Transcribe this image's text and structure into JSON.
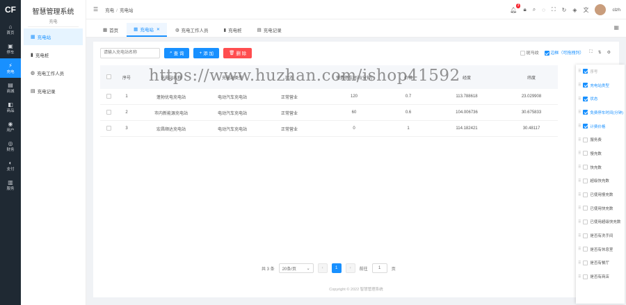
{
  "leftbar": {
    "logo": "CF",
    "items": [
      {
        "icon": "⌂",
        "label": "首页"
      },
      {
        "icon": "▣",
        "label": "停车"
      },
      {
        "icon": "⚡",
        "label": "充电"
      },
      {
        "icon": "▤",
        "label": "商城"
      },
      {
        "icon": "◧",
        "label": "商品"
      },
      {
        "icon": "◉",
        "label": "用户"
      },
      {
        "icon": "◎",
        "label": "财务"
      },
      {
        "icon": "◐",
        "label": "支付"
      },
      {
        "icon": "▥",
        "label": "服务"
      }
    ]
  },
  "sidebar": {
    "title": "智慧管理系统",
    "subtitle": "充电",
    "items": [
      {
        "icon": "▦",
        "label": "充电站"
      },
      {
        "icon": "▮",
        "label": "充电桩"
      },
      {
        "icon": "◍",
        "label": "充电工作人员"
      },
      {
        "icon": "▤",
        "label": "充电记录"
      }
    ]
  },
  "header": {
    "collapse_icon": "☰",
    "breadcrumb": [
      "充电",
      "充电站"
    ],
    "notification_count": "3",
    "username": "clzh"
  },
  "tabs": {
    "items": [
      {
        "icon": "▦",
        "label": "首页"
      },
      {
        "icon": "▦",
        "label": "充电站"
      },
      {
        "icon": "◍",
        "label": "充电工作人员"
      },
      {
        "icon": "▮",
        "label": "充电桩"
      },
      {
        "icon": "▤",
        "label": "充电记录"
      }
    ]
  },
  "toolbar": {
    "search_placeholder": "请输入充电站名称",
    "query_label": "查 询",
    "add_label": "添 加",
    "delete_label": "删 除",
    "borderless_label": "斑马纹",
    "header_setting_label": "边框（可拖拽列）"
  },
  "table": {
    "headers": [
      "序号",
      "充电站名称",
      "充电站类型",
      "状态",
      "免费停车时间(分钟)",
      "价格",
      "经度",
      "纬度"
    ],
    "rows": [
      {
        "idx": "1",
        "name": "蓬勃优电充电站",
        "type": "电动汽车充电站",
        "status": "正常营业",
        "fee": "120",
        "price": "0.7",
        "lng": "113.788618",
        "lat": "23.029908"
      },
      {
        "idx": "2",
        "name": "市内新能源充电站",
        "type": "电动汽车充电站",
        "status": "正常营业",
        "fee": "60",
        "price": "0.6",
        "lng": "104.006736",
        "lat": "30.675833"
      },
      {
        "idx": "3",
        "name": "宏昌顺达充电站",
        "type": "电动汽车充电站",
        "status": "正常营业",
        "fee": "0",
        "price": "1",
        "lng": "114.182421",
        "lat": "30.48117"
      }
    ]
  },
  "pagination": {
    "total_text": "共 3 条",
    "page_size": "20条/页",
    "current_page": "1",
    "goto_label": "前往",
    "goto_value": "1",
    "page_suffix": "页"
  },
  "footer": {
    "copyright": "Copyright © 2022 智慧管理系统"
  },
  "column_settings": {
    "items": [
      {
        "label": "序号",
        "state": "gray"
      },
      {
        "label": "充电站类型",
        "state": "on"
      },
      {
        "label": "状态",
        "state": "on"
      },
      {
        "label": "免费停车时间(分钟)",
        "state": "on"
      },
      {
        "label": "计费价格",
        "state": "on"
      },
      {
        "label": "服务费",
        "state": "off"
      },
      {
        "label": "慢充数",
        "state": "off"
      },
      {
        "label": "快充数",
        "state": "off"
      },
      {
        "label": "超级快充数",
        "state": "off"
      },
      {
        "label": "已使用慢充数",
        "state": "off"
      },
      {
        "label": "已使用快充数",
        "state": "off"
      },
      {
        "label": "已使用超级快充数",
        "state": "off"
      },
      {
        "label": "是否有洗手间",
        "state": "off"
      },
      {
        "label": "是否有休息室",
        "state": "off"
      },
      {
        "label": "是否有餐厅",
        "state": "off"
      },
      {
        "label": "是否有商店",
        "state": "off"
      }
    ]
  },
  "watermark": "https://www.huzhan.com/ishop41592"
}
